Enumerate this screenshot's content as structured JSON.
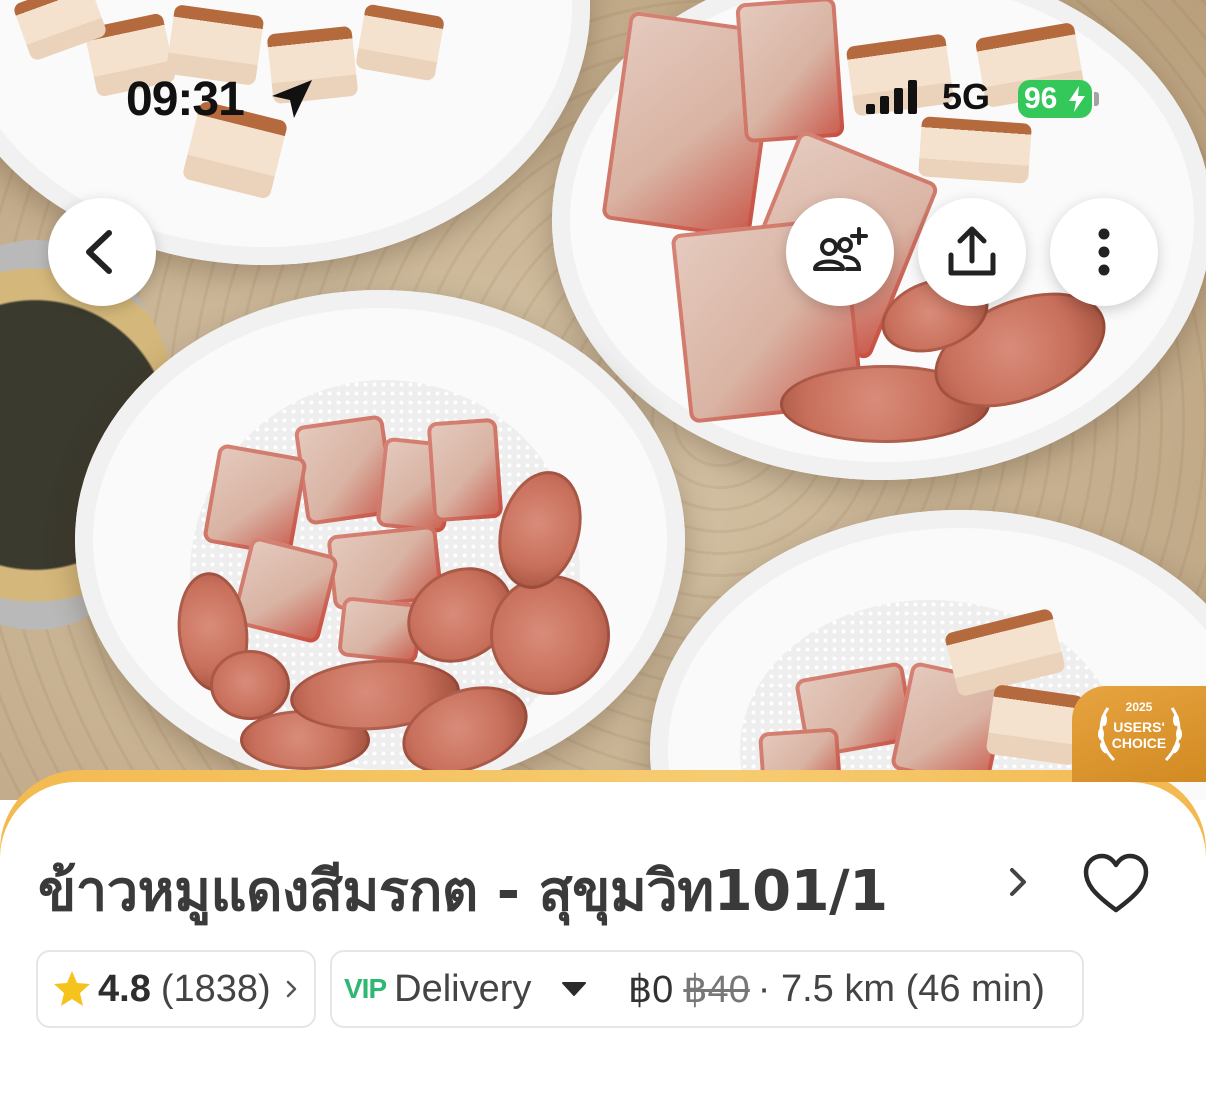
{
  "status_bar": {
    "time": "09:31",
    "network": "5G",
    "battery": "96"
  },
  "actions": {
    "back": "back",
    "group_order": "group-order",
    "share": "share",
    "more": "more"
  },
  "award": {
    "year": "2025",
    "line1": "USERS'",
    "line2": "CHOICE"
  },
  "restaurant": {
    "name": "ข้าวหมูแดงสีมรกต - สุขุมวิท101/1",
    "rating": "4.8",
    "review_count": "(1838)",
    "delivery_badge": "VIP",
    "delivery_mode": "Delivery",
    "fee_current": "฿0",
    "fee_original": "฿40",
    "distance_time": "· 7.5 km (46 min)"
  },
  "colors": {
    "accent": "#f3ba50",
    "star": "#f6c21c",
    "battery": "#34c759",
    "vip_blue": "#3aa6e6",
    "vip_green": "#2fb873"
  },
  "icons": [
    "location-arrow-icon",
    "signal-icon",
    "battery-bolt-icon",
    "back-chevron-icon",
    "add-people-icon",
    "share-icon",
    "more-vertical-icon",
    "laurel-icon",
    "chevron-right-icon",
    "heart-icon",
    "star-icon",
    "caret-down-icon"
  ]
}
